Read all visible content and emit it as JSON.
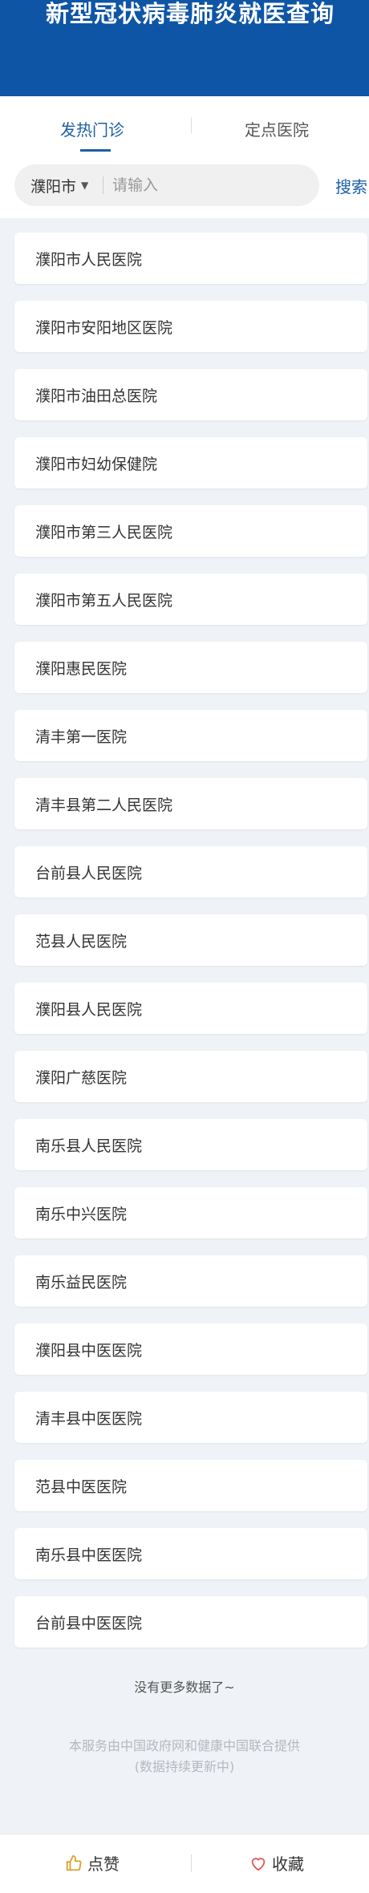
{
  "header": {
    "title": "新型冠状病毒肺炎就医查询"
  },
  "tabs": [
    {
      "label": "发热门诊",
      "active": true
    },
    {
      "label": "定点医院",
      "active": false
    }
  ],
  "search": {
    "city": "濮阳市",
    "placeholder": "请输入",
    "value": "",
    "button": "搜索"
  },
  "hospitals": [
    "濮阳市人民医院",
    "濮阳市安阳地区医院",
    "濮阳市油田总医院",
    "濮阳市妇幼保健院",
    "濮阳市第三人民医院",
    "濮阳市第五人民医院",
    "濮阳惠民医院",
    "清丰第一医院",
    "清丰县第二人民医院",
    "台前县人民医院",
    "范县人民医院",
    "濮阳县人民医院",
    "濮阳广慈医院",
    "南乐县人民医院",
    "南乐中兴医院",
    "南乐益民医院",
    "濮阳县中医医院",
    "清丰县中医医院",
    "范县中医医院",
    "南乐县中医医院",
    "台前县中医医院"
  ],
  "footer": {
    "no_more": "没有更多数据了~",
    "disclaimer_line1": "本服务由中国政府网和健康中国联合提供",
    "disclaimer_line2": "(数据持续更新中)"
  },
  "bottom_bar": {
    "like_label": "点赞",
    "favorite_label": "收藏"
  },
  "colors": {
    "header_bg": "#0f55a6",
    "accent": "#1c5fa8",
    "like_icon": "#e0a030",
    "favorite_icon": "#e05a5a"
  }
}
